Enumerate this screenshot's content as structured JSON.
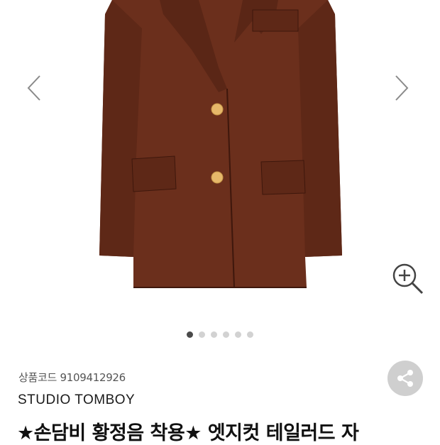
{
  "product": {
    "code_label": "상품코드",
    "code_value": "9109412926",
    "brand": "STUDIO TOMBOY",
    "title": "★손담비 황정음 착용★ 엣지컷 테일러드 자"
  },
  "gallery": {
    "slide_count": 6,
    "active_slide": 1,
    "colors": {
      "jacket": "#6b2f1c",
      "jacket_dark": "#4e1f12",
      "lining": "#b7b49d",
      "button": "#e6b86a"
    }
  }
}
